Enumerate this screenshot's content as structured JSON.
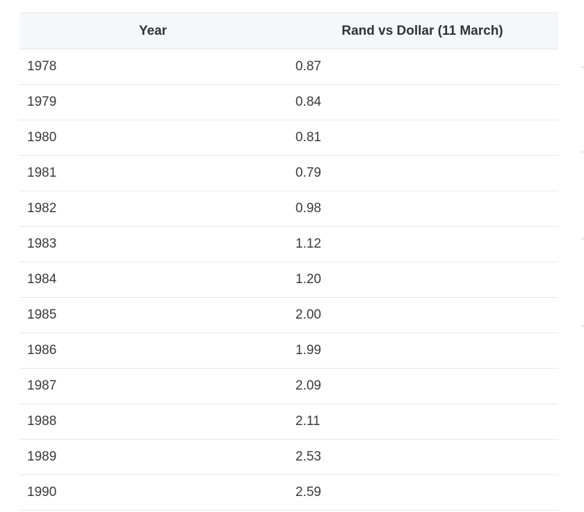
{
  "table": {
    "headers": [
      "Year",
      "Rand vs Dollar (11 March)"
    ],
    "rows": [
      [
        "1978",
        "0.87"
      ],
      [
        "1979",
        "0.84"
      ],
      [
        "1980",
        "0.81"
      ],
      [
        "1981",
        "0.79"
      ],
      [
        "1982",
        "0.98"
      ],
      [
        "1983",
        "1.12"
      ],
      [
        "1984",
        "1.20"
      ],
      [
        "1985",
        "2.00"
      ],
      [
        "1986",
        "1.99"
      ],
      [
        "1987",
        "2.09"
      ],
      [
        "1988",
        "2.11"
      ],
      [
        "1989",
        "2.53"
      ],
      [
        "1990",
        "2.59"
      ]
    ]
  }
}
